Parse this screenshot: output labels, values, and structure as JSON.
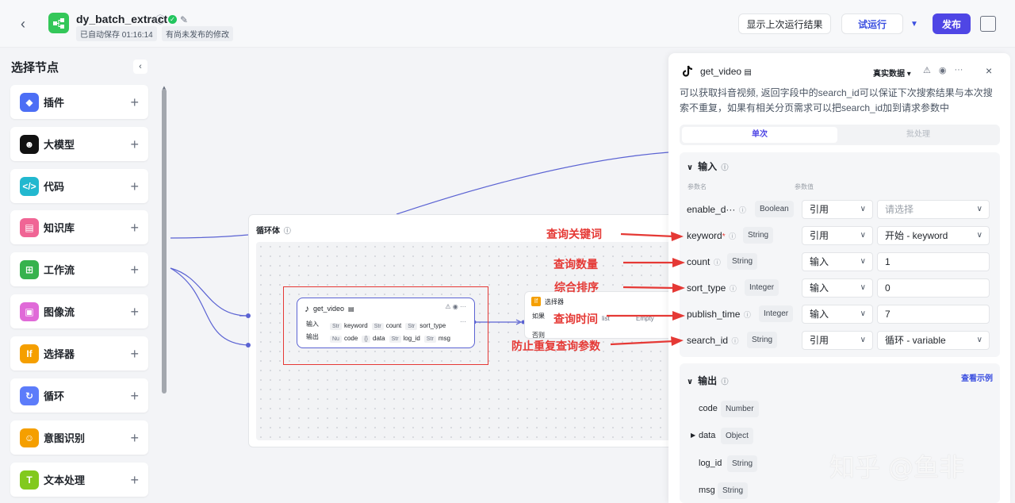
{
  "header": {
    "title": "dy_batch_extract",
    "autosave": "已自动保存 01:16:14",
    "unpublished": "有尚未发布的修改",
    "show_last_run": "显示上次运行结果",
    "test_run": "试运行",
    "publish": "发布"
  },
  "left_panel": {
    "title": "选择节点",
    "items": [
      {
        "label": "插件",
        "color": "#4c6ef5",
        "glyph": "◆"
      },
      {
        "label": "大模型",
        "color": "#111111",
        "glyph": "☻"
      },
      {
        "label": "代码",
        "color": "#22b8cf",
        "glyph": "</>"
      },
      {
        "label": "知识库",
        "color": "#f06595",
        "glyph": "▤"
      },
      {
        "label": "工作流",
        "color": "#37b24d",
        "glyph": "⊞"
      },
      {
        "label": "图像流",
        "color": "#e06ad8",
        "glyph": "▣"
      },
      {
        "label": "选择器",
        "color": "#f59f00",
        "glyph": "If"
      },
      {
        "label": "循环",
        "color": "#5c7cfa",
        "glyph": "↻"
      },
      {
        "label": "意图识别",
        "color": "#f59f00",
        "glyph": "☺"
      },
      {
        "label": "文本处理",
        "color": "#82c91e",
        "glyph": "T"
      }
    ]
  },
  "canvas": {
    "loop_title": "循环体",
    "getvideo_node": {
      "title": "get_video",
      "input_label": "输入",
      "output_label": "输出",
      "inputs": [
        {
          "type": "Str",
          "name": "keyword"
        },
        {
          "type": "Str",
          "name": "count"
        },
        {
          "type": "Str",
          "name": "sort_type"
        }
      ],
      "outputs": [
        {
          "type": "Nu",
          "name": "code"
        },
        {
          "type": "{}",
          "name": "data"
        },
        {
          "type": "Str",
          "name": "log_id"
        },
        {
          "type": "Str",
          "name": "msg"
        }
      ]
    },
    "selector_node": {
      "title": "选择器",
      "if_label": "如果",
      "else_label": "否则",
      "cond_text": "list",
      "cond_value": "Empty"
    }
  },
  "right_panel": {
    "title": "get_video",
    "data_mode": "真实数据",
    "description": "可以获取抖音视频, 返回字段中的search_id可以保证下次搜索结果与本次搜索不重复，如果有相关分页需求可以把search_id加到请求参数中",
    "tab_single": "单次",
    "tab_batch": "批处理",
    "input_title": "输入",
    "col_name": "参数名",
    "col_value": "参数值",
    "params": [
      {
        "name": "enable_d···",
        "type": "Boolean",
        "mode": "引用",
        "value": "请选择",
        "required": false
      },
      {
        "name": "keyword",
        "type": "String",
        "mode": "引用",
        "value": "开始 - keyword",
        "required": true
      },
      {
        "name": "count",
        "type": "String",
        "mode": "输入",
        "value": "1",
        "required": false
      },
      {
        "name": "sort_type",
        "type": "Integer",
        "mode": "输入",
        "value": "0",
        "required": false
      },
      {
        "name": "publish_time",
        "type": "Integer",
        "mode": "输入",
        "value": "7",
        "required": false
      },
      {
        "name": "search_id",
        "type": "String",
        "mode": "引用",
        "value": "循环 - variable",
        "required": false
      }
    ],
    "output_title": "输出",
    "view_example": "查看示例",
    "outputs": [
      {
        "name": "code",
        "type": "Number"
      },
      {
        "name": "data",
        "type": "Object"
      },
      {
        "name": "log_id",
        "type": "String"
      },
      {
        "name": "msg",
        "type": "String"
      }
    ]
  },
  "annotations": [
    "查询关键词",
    "查询数量",
    "综合排序",
    "查询时间",
    "防止重复查询参数"
  ],
  "watermark": "知乎 @鱼非",
  "colors": {
    "accent": "#4f46e5",
    "annotation": "#e53935"
  }
}
